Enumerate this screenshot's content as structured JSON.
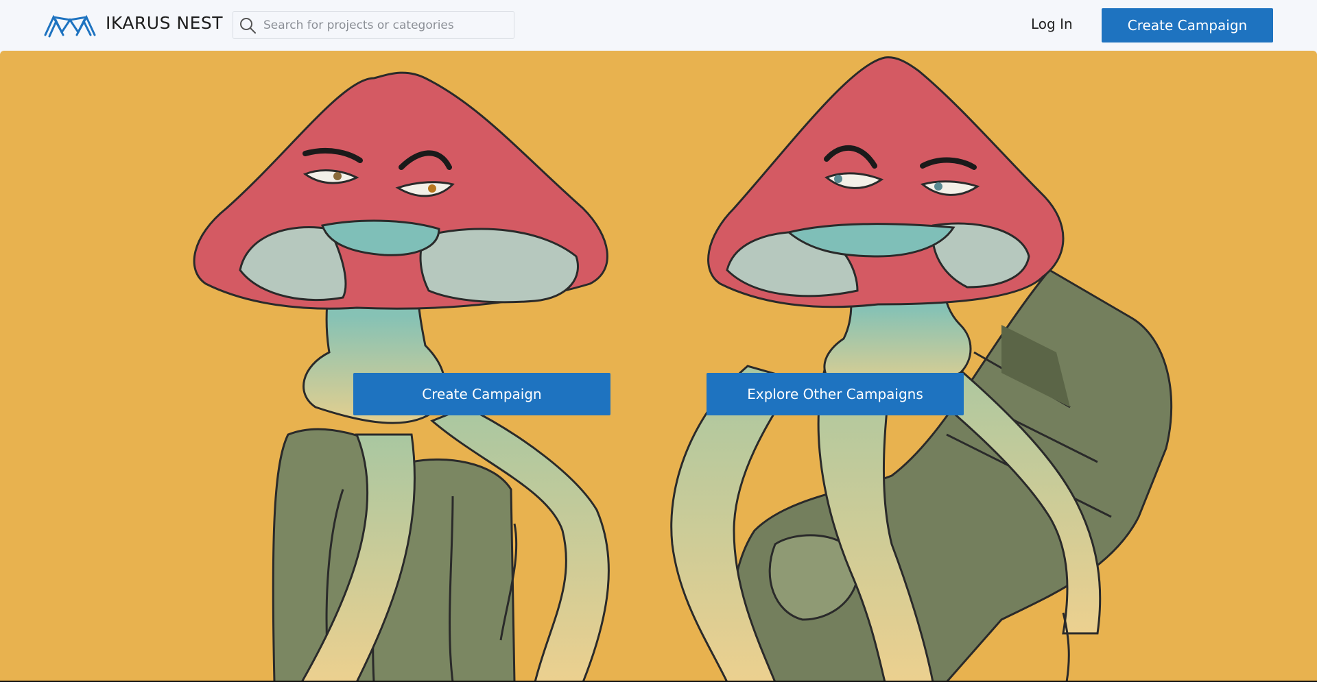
{
  "header": {
    "brand_name": "IKARUS NEST",
    "search": {
      "placeholder": "Search for projects or categories",
      "value": ""
    },
    "login_label": "Log In",
    "create_campaign_label": "Create Campaign"
  },
  "hero": {
    "create_campaign_label": "Create Campaign",
    "explore_label": "Explore Other Campaigns",
    "background_color": "#e8b24f"
  },
  "colors": {
    "accent": "#1e73c0",
    "hero_background": "#e8b24f",
    "mushroom_cap": "#d45a63",
    "mushroom_stem": "#7fbfb8",
    "rock": "#7b8762"
  },
  "icons": {
    "logo": "ikarus-wings-logo",
    "search": "search-icon"
  }
}
